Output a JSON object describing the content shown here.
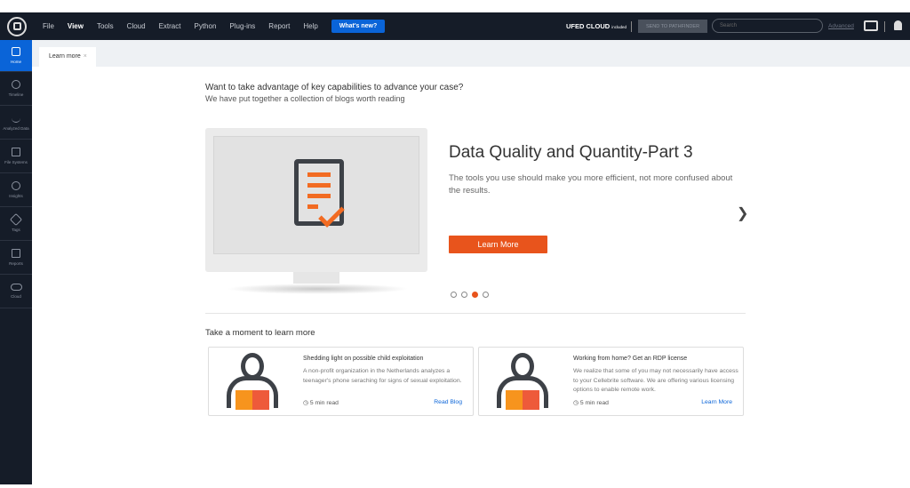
{
  "menu": [
    "File",
    "View",
    "Tools",
    "Cloud",
    "Extract",
    "Python",
    "Plug-ins",
    "Report",
    "Help"
  ],
  "whats_new": "What's new?",
  "ufed": "UFED CLOUD",
  "ufed_badge": "included",
  "send": "SEND TO PATHFINDER",
  "search_placeholder": "Search",
  "advanced": "Advanced",
  "sidebar": [
    {
      "label": "Home"
    },
    {
      "label": "Timeline"
    },
    {
      "label": "Analyzed Data"
    },
    {
      "label": "File Systems"
    },
    {
      "label": "Insights"
    },
    {
      "label": "Tags"
    },
    {
      "label": "Reports"
    },
    {
      "label": "Cloud"
    }
  ],
  "tab": "Learn more",
  "intro": {
    "line1": "Want to take advantage of key capabilities to advance your case?",
    "line2": "We have put together a collection of blogs worth reading"
  },
  "hero": {
    "title": "Data Quality and Quantity-Part 3",
    "desc": "The tools you use should make you more efficient, not more confused about the results.",
    "button": "Learn More",
    "active_slide": 3,
    "slides": 4
  },
  "section_title": "Take a moment to learn more",
  "cards": [
    {
      "title": "Shedding light on possible child exploitation",
      "desc": "A non-profit organization in the Netherlands analyzes a teenager's phone seraching for signs of sexual exploitation.",
      "read": "5 min read",
      "link": "Read Blog"
    },
    {
      "title": "Working from home? Get an RDP license",
      "desc": "We realize that some of you may not necessarily have access to your Cellebrite software. We are offering various licensing options to enable remote work.",
      "read": "5 min read",
      "link": "Learn More"
    }
  ],
  "colors": {
    "accent": "#0a64d8",
    "orange": "#e8541c",
    "topbar": "#151c28"
  }
}
